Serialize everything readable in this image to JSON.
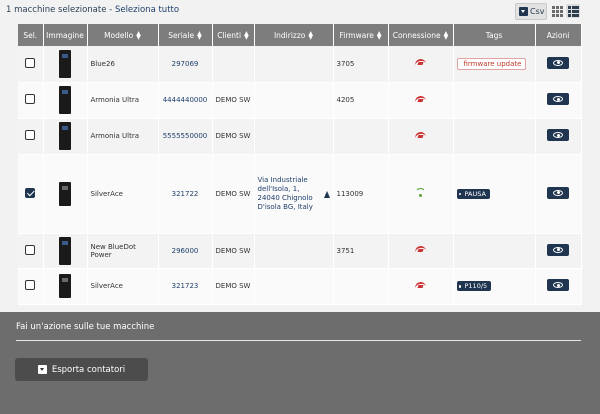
{
  "selection": {
    "count_text": "1 macchine selezionate",
    "separator": " - ",
    "select_all": "Seleziona tutto"
  },
  "toolbar": {
    "csv_label": "Csv"
  },
  "table": {
    "headers": [
      "Sel.",
      "Immagine",
      "Modello",
      "Seriale",
      "Clienti",
      "Indirizzo",
      "Firmware",
      "Connessione",
      "Tags",
      "Azioni"
    ],
    "rows": [
      {
        "selected": false,
        "model": "Blue26",
        "serial": "297069",
        "client": "",
        "address": "",
        "firmware": "3705",
        "connection": "offline",
        "tag": "firmware update"
      },
      {
        "selected": false,
        "model": "Armonia Ultra",
        "serial": "4444440000",
        "client": "DEMO SW",
        "address": "",
        "firmware": "4205",
        "connection": "offline",
        "tag": ""
      },
      {
        "selected": false,
        "model": "Armonia Ultra",
        "serial": "5555550000",
        "client": "DEMO SW",
        "address": "",
        "firmware": "",
        "connection": "offline",
        "tag": ""
      },
      {
        "selected": true,
        "model": "SilverAce",
        "serial": "321722",
        "client": "DEMO SW",
        "address": "Via Industriale dell'Isola, 1, 24040 Chignolo D'isola BG, Italy",
        "firmware": "113009",
        "connection": "online",
        "tag": "PAUSA"
      },
      {
        "selected": false,
        "model": "New BlueDot Power",
        "serial": "296000",
        "client": "DEMO SW",
        "address": "",
        "firmware": "3751",
        "connection": "offline",
        "tag": ""
      },
      {
        "selected": false,
        "model": "SilverAce",
        "serial": "321723",
        "client": "DEMO SW",
        "address": "",
        "firmware": "",
        "connection": "offline",
        "tag": "P110/5"
      }
    ]
  },
  "panel": {
    "title": "Fai un'azione sulle tue macchine",
    "export_label": "Esporta contatori"
  },
  "colors": {
    "header_bg": "#7d7d7d",
    "primary": "#1f3550",
    "offline": "#cc3333",
    "online": "#5aa23a",
    "panel_bg": "#6d6d6d"
  }
}
